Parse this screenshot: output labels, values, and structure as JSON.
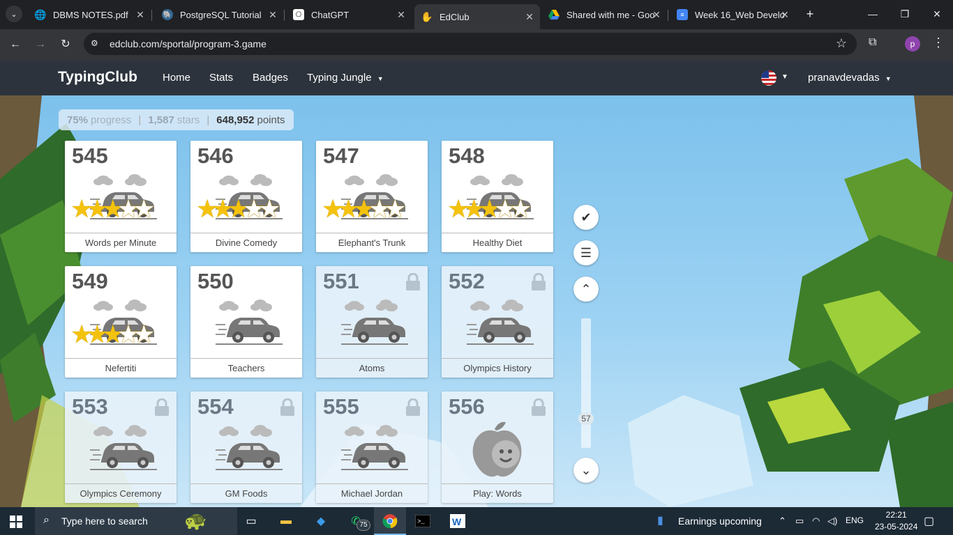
{
  "browser": {
    "tabs": [
      {
        "title": "DBMS NOTES.pdf",
        "icon": "globe-icon",
        "active": false
      },
      {
        "title": "PostgreSQL Tutorial",
        "icon": "postgresql-icon",
        "active": false
      },
      {
        "title": "ChatGPT",
        "icon": "chatgpt-icon",
        "active": false
      },
      {
        "title": "EdClub",
        "icon": "edclub-icon",
        "active": true
      },
      {
        "title": "Shared with me - Goo",
        "icon": "google-drive-icon",
        "active": false
      },
      {
        "title": "Week 16_Web Develo",
        "icon": "google-docs-icon",
        "active": false
      }
    ],
    "url": "edclub.com/sportal/program-3.game",
    "profile_initial": "p"
  },
  "site": {
    "brand": "TypingClub",
    "nav": [
      "Home",
      "Stats",
      "Badges",
      "Typing Jungle"
    ],
    "username": "pranavdevadas"
  },
  "progress": {
    "percent_label": "75%",
    "percent_text": "progress",
    "stars_count": "1,587",
    "stars_text": "stars",
    "points_count": "648,952",
    "points_text": "points"
  },
  "lessons": [
    {
      "number": "545",
      "title": "Words per Minute",
      "stars": 3,
      "locked": false,
      "art": "car"
    },
    {
      "number": "546",
      "title": "Divine Comedy",
      "stars": 3,
      "locked": false,
      "art": "car"
    },
    {
      "number": "547",
      "title": "Elephant's Trunk",
      "stars": 3,
      "locked": false,
      "art": "car"
    },
    {
      "number": "548",
      "title": "Healthy Diet",
      "stars": 3,
      "locked": false,
      "art": "car"
    },
    {
      "number": "549",
      "title": "Nefertiti",
      "stars": 3,
      "locked": false,
      "art": "car"
    },
    {
      "number": "550",
      "title": "Teachers",
      "stars": 0,
      "locked": false,
      "art": "car"
    },
    {
      "number": "551",
      "title": "Atoms",
      "stars": 0,
      "locked": true,
      "art": "car"
    },
    {
      "number": "552",
      "title": "Olympics History",
      "stars": 0,
      "locked": true,
      "art": "car"
    },
    {
      "number": "553",
      "title": "Olympics Ceremony",
      "stars": 0,
      "locked": true,
      "art": "car"
    },
    {
      "number": "554",
      "title": "GM Foods",
      "stars": 0,
      "locked": true,
      "art": "car"
    },
    {
      "number": "555",
      "title": "Michael Jordan",
      "stars": 0,
      "locked": true,
      "art": "car"
    },
    {
      "number": "556",
      "title": "Play: Words",
      "stars": 0,
      "locked": true,
      "art": "apple-game"
    }
  ],
  "scroll": {
    "position_label": "57"
  },
  "taskbar": {
    "search_placeholder": "Type here to search",
    "whatsapp_badge": "75",
    "news": "Earnings upcoming",
    "lang": "ENG",
    "time": "22:21",
    "date": "23-05-2024"
  },
  "colors": {
    "header_bg": "#2c333c",
    "sky": "#7cc1ec",
    "star": "#f4c20d",
    "taskbar": "#1c2a36"
  }
}
